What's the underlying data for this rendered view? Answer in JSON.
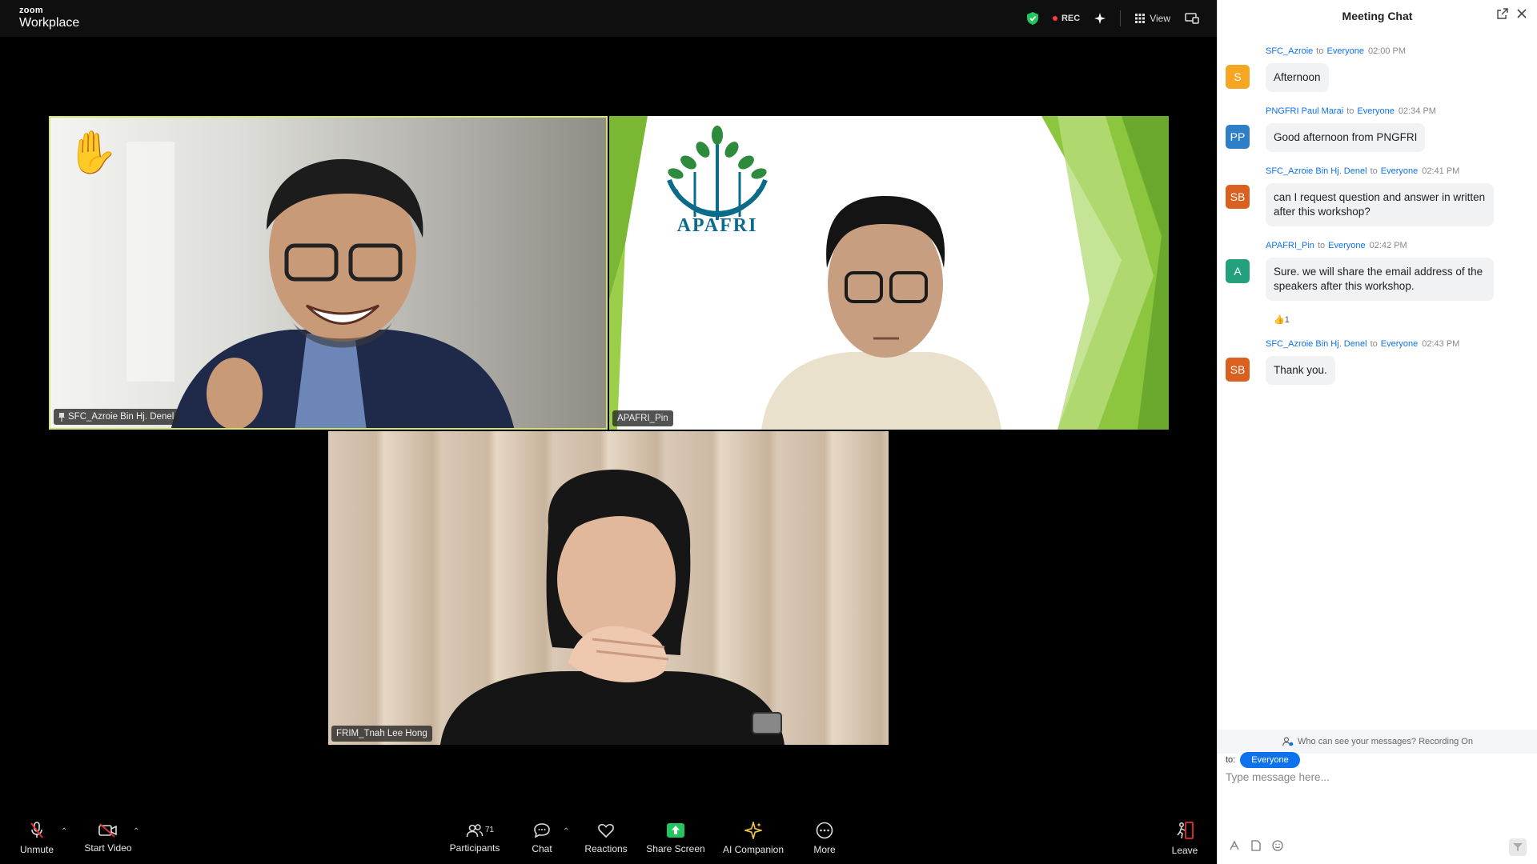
{
  "app": {
    "brand_top": "zoom",
    "brand_bottom": "Workplace",
    "rec_label": "REC",
    "view_label": "View"
  },
  "participants": [
    {
      "name": "SFC_Azroie Bin Hj. Denel",
      "pinned": true,
      "hand_raised": true,
      "active_speaker": true
    },
    {
      "name": "APAFRI_Pin",
      "logo_text": "APAFRI"
    },
    {
      "name": "FRIM_Tnah Lee Hong"
    }
  ],
  "toolbar": {
    "unmute": "Unmute",
    "start_video": "Start Video",
    "participants": "Participants",
    "participant_count": "71",
    "chat": "Chat",
    "reactions": "Reactions",
    "share_screen": "Share Screen",
    "ai_companion": "AI Companion",
    "more": "More",
    "leave": "Leave"
  },
  "chat": {
    "title": "Meeting Chat",
    "to_word": "to",
    "messages": [
      {
        "sender": "SFC_Azroie",
        "recipient": "Everyone",
        "time": "02:00 PM",
        "initials": "S",
        "avatar_color": "#f5a623",
        "text": "Afternoon"
      },
      {
        "sender": "PNGFRI Paul Marai",
        "recipient": "Everyone",
        "time": "02:34 PM",
        "initials": "PP",
        "avatar_color": "#2f7fc8",
        "text": "Good afternoon from PNGFRI"
      },
      {
        "sender": "SFC_Azroie Bin Hj. Denel",
        "recipient": "Everyone",
        "time": "02:41 PM",
        "initials": "SB",
        "avatar_color": "#d9601e",
        "text": "can I request question and answer in written after this workshop?"
      },
      {
        "sender": "APAFRI_Pin",
        "recipient": "Everyone",
        "time": "02:42 PM",
        "initials": "A",
        "avatar_color": "#24a07c",
        "text": "Sure. we will share the email address of the speakers after this workshop.",
        "reaction": "👍1"
      },
      {
        "sender": "SFC_Azroie Bin Hj. Denel",
        "recipient": "Everyone",
        "time": "02:43 PM",
        "initials": "SB",
        "avatar_color": "#d9601e",
        "text": "Thank you."
      }
    ],
    "privacy_note": "Who can see your messages? Recording On",
    "to_label": "to:",
    "recipient_pill": "Everyone",
    "input_placeholder": "Type message here..."
  },
  "colors": {
    "accent": "#0e72ed",
    "speaker_border": "#d6e36a",
    "rec_red": "#ff3b3b",
    "leave_red": "#e0312c",
    "ai_star": "#f2c94c",
    "share_green": "#22c55e"
  },
  "icons": [
    "shield-icon",
    "rec-dot-icon",
    "sparkle-icon",
    "grid-icon",
    "screen-icon",
    "hand-raise-icon",
    "pin-icon",
    "mic-muted-icon",
    "video-muted-icon",
    "participants-icon",
    "chat-icon",
    "reactions-icon",
    "share-screen-icon",
    "ai-companion-icon",
    "more-icon",
    "leave-icon",
    "popout-icon",
    "close-icon",
    "privacy-icon",
    "format-icon",
    "file-icon",
    "emoji-icon",
    "send-icon"
  ]
}
